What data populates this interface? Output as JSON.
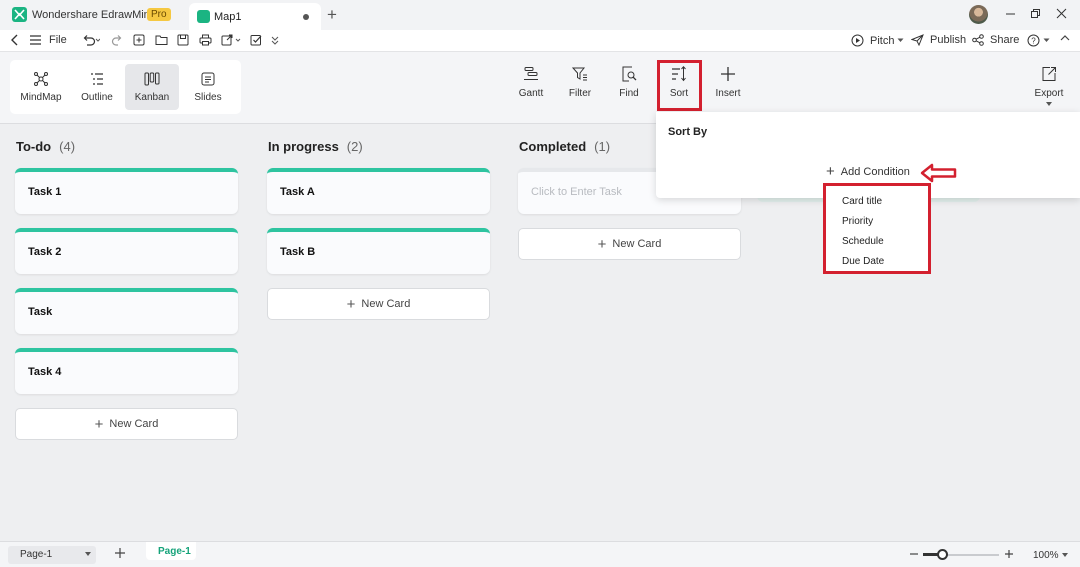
{
  "app": {
    "name": "Wondershare EdrawMind",
    "badge": "Pro"
  },
  "tab": {
    "title": "Map1"
  },
  "menubar": {
    "file": "File",
    "pitch": "Pitch",
    "publish": "Publish",
    "share": "Share"
  },
  "views": [
    {
      "label": "MindMap",
      "icon": "mindmap-icon"
    },
    {
      "label": "Outline",
      "icon": "outline-icon"
    },
    {
      "label": "Kanban",
      "icon": "kanban-icon",
      "active": true
    },
    {
      "label": "Slides",
      "icon": "slides-icon"
    }
  ],
  "tools": {
    "gantt": "Gantt",
    "filter": "Filter",
    "find": "Find",
    "sort": "Sort",
    "insert": "Insert",
    "export": "Export"
  },
  "columns": [
    {
      "title": "To-do",
      "count": "(4)",
      "cards": [
        "Task 1",
        "Task 2",
        "Task",
        "Task 4"
      ],
      "new_card": "New Card"
    },
    {
      "title": "In progress",
      "count": "(2)",
      "cards": [
        "Task A",
        "Task B"
      ],
      "new_card": "New Card"
    },
    {
      "title": "Completed",
      "count": "(1)",
      "placeholder": "Click to Enter Task",
      "new_card": "New Card"
    }
  ],
  "sort_panel": {
    "title": "Sort By",
    "add_condition": "Add Condition",
    "options": [
      "Card title",
      "Priority",
      "Schedule",
      "Due Date"
    ]
  },
  "status": {
    "page_select": "Page-1",
    "page_tab": "Page-1",
    "zoom": "100%",
    "zoom_level": 0.25
  },
  "colors": {
    "accent": "#2ec4a0",
    "highlight": "#d3202f",
    "brand": "#1bb482"
  }
}
